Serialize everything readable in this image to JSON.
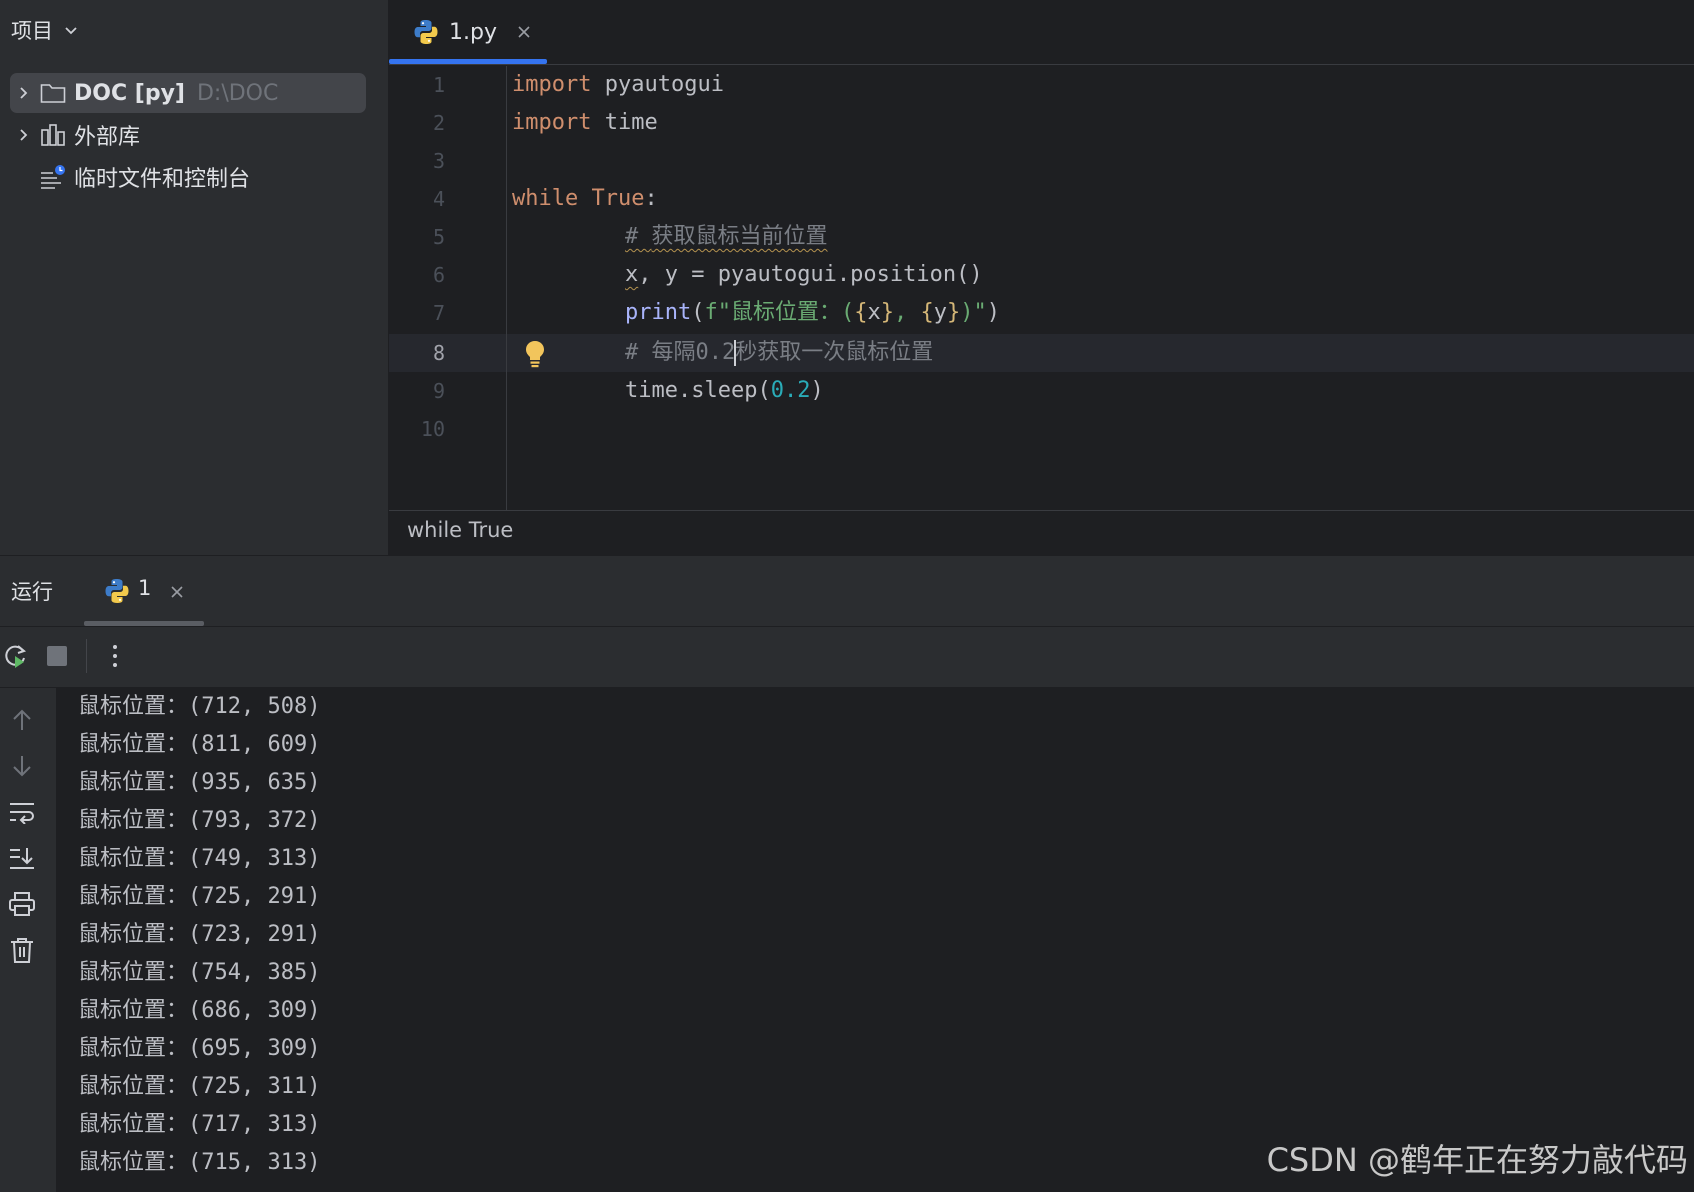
{
  "project": {
    "header": "项目",
    "items": [
      {
        "name": "DOC [py]",
        "path": "D:\\DOC"
      },
      {
        "name": "外部库"
      },
      {
        "name": "临时文件和控制台"
      }
    ]
  },
  "editor": {
    "tab": "1.py",
    "line_numbers": [
      "1",
      "2",
      "3",
      "4",
      "5",
      "6",
      "7",
      "8",
      "9",
      "10"
    ],
    "code": {
      "l1_kw": "import",
      "l1_rest": " pyautogui",
      "l2_kw": "import",
      "l2_rest": " time",
      "l4_kw": "while",
      "l4_sp": " ",
      "l4_true": "True",
      "l4_colon": ":",
      "l5_hash": "# ",
      "l5_text": "获取鼠标当前位置",
      "l6_x": "x",
      "l6_rest": ", y = pyautogui.position()",
      "l7_fn": "print",
      "l7_p1": "(",
      "l7_str1": "f\"鼠标位置：(",
      "l7_b1": "{",
      "l7_x": "x",
      "l7_b2": "}",
      "l7_str2": ", ",
      "l7_b3": "{",
      "l7_y": "y",
      "l7_b4": "}",
      "l7_str3": ")\"",
      "l7_p2": ")",
      "l8_a": "# 每隔0.2",
      "l8_b": "秒获取一次鼠标位置",
      "l9_a": "time.sleep(",
      "l9_num": "0.2",
      "l9_b": ")"
    },
    "breadcrumb": "while True"
  },
  "run": {
    "title": "运行",
    "tab": "1",
    "output": [
      "鼠标位置：(712, 508)",
      "鼠标位置：(811, 609)",
      "鼠标位置：(935, 635)",
      "鼠标位置：(793, 372)",
      "鼠标位置：(749, 313)",
      "鼠标位置：(725, 291)",
      "鼠标位置：(723, 291)",
      "鼠标位置：(754, 385)",
      "鼠标位置：(686, 309)",
      "鼠标位置：(695, 309)",
      "鼠标位置：(725, 311)",
      "鼠标位置：(717, 313)",
      "鼠标位置：(715, 313)"
    ]
  },
  "watermark": "CSDN @鹤年正在努力敲代码",
  "colors": {
    "accent": "#3574f0",
    "keyword": "#cf8e6d",
    "string": "#6aab73",
    "number": "#2aacb8",
    "comment": "#7a7e85",
    "function": "#a9b4fb"
  },
  "icons": [
    "chevron-down-icon",
    "chevron-right-icon",
    "folder-icon",
    "library-icon",
    "scratches-icon",
    "python-file-icon",
    "close-icon",
    "bulb-icon",
    "rerun-icon",
    "stop-icon",
    "more-icon",
    "arrow-up-icon",
    "arrow-down-icon",
    "soft-wrap-icon",
    "scroll-to-end-icon",
    "print-icon",
    "trash-icon"
  ]
}
